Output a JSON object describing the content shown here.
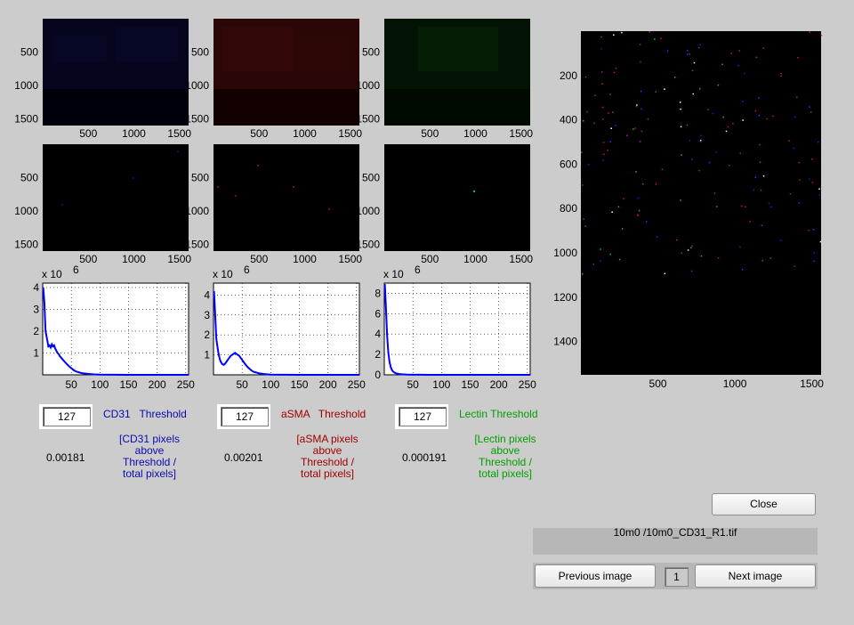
{
  "colors": {
    "cd31": "#0a0ab4",
    "asma": "#a00000",
    "lectin": "#00a000",
    "hist_line": "#0000ff"
  },
  "channels": [
    {
      "name": "CD31",
      "label": "CD31   Threshold",
      "threshold": "127",
      "ratio": "0.00181",
      "desc": [
        "[CD31 pixels",
        "above",
        "Threshold /",
        "total pixels]"
      ],
      "color_key": "cd31"
    },
    {
      "name": "aSMA",
      "label": "aSMA   Threshold",
      "threshold": "127",
      "ratio": "0.00201",
      "desc": [
        "[aSMA pixels",
        "above",
        "Threshold /",
        "total pixels]"
      ],
      "color_key": "asma"
    },
    {
      "name": "Lectin",
      "label": "Lectin Threshold",
      "threshold": "127",
      "ratio": "0.000191",
      "desc": [
        "[Lectin pixels",
        "above",
        "Threshold /",
        "total pixels]"
      ],
      "color_key": "lectin"
    }
  ],
  "image_axes": {
    "x_ticks": [
      "500",
      "1000",
      "1500"
    ],
    "y_ticks": [
      "500",
      "1000",
      "1500"
    ]
  },
  "composite_axes": {
    "x_ticks": [
      "500",
      "1000",
      "1500"
    ],
    "y_ticks": [
      "200",
      "400",
      "600",
      "800",
      "1000",
      "1200",
      "1400"
    ]
  },
  "chart_data": [
    {
      "type": "line",
      "name": "CD31 histogram",
      "exponent_label": "x 10",
      "exponent": "6",
      "x_ticks": [
        "50",
        "100",
        "150",
        "200",
        "250"
      ],
      "y_ticks": [
        "1",
        "2",
        "3",
        "4"
      ],
      "xlim": [
        0,
        255
      ],
      "ylim": [
        0,
        4.2
      ],
      "x": [
        1,
        3,
        5,
        8,
        10,
        12,
        14,
        16,
        18,
        20,
        22,
        24,
        26,
        28,
        30,
        35,
        40,
        45,
        50,
        55,
        60,
        65,
        70,
        80,
        90,
        100,
        120,
        150,
        200,
        255
      ],
      "y": [
        4.0,
        3.3,
        2.0,
        1.6,
        1.3,
        1.35,
        1.25,
        1.4,
        1.3,
        1.35,
        1.2,
        1.1,
        1.0,
        0.95,
        0.85,
        0.7,
        0.55,
        0.42,
        0.3,
        0.2,
        0.14,
        0.1,
        0.07,
        0.04,
        0.02,
        0.01,
        0.005,
        0.002,
        0.0,
        0.0
      ]
    },
    {
      "type": "line",
      "name": "aSMA histogram",
      "exponent_label": "x 10",
      "exponent": "6",
      "x_ticks": [
        "50",
        "100",
        "150",
        "200",
        "250"
      ],
      "y_ticks": [
        "1",
        "2",
        "3",
        "4"
      ],
      "xlim": [
        0,
        255
      ],
      "ylim": [
        0,
        4.6
      ],
      "x": [
        1,
        3,
        5,
        8,
        10,
        12,
        15,
        18,
        20,
        25,
        30,
        35,
        38,
        40,
        45,
        50,
        55,
        60,
        65,
        70,
        80,
        90,
        100,
        120,
        150,
        200,
        255
      ],
      "y": [
        4.2,
        3.0,
        1.8,
        1.2,
        0.9,
        0.7,
        0.55,
        0.5,
        0.55,
        0.75,
        0.95,
        1.05,
        1.1,
        1.05,
        0.95,
        0.75,
        0.55,
        0.38,
        0.25,
        0.15,
        0.07,
        0.03,
        0.015,
        0.005,
        0.002,
        0.0,
        0.0
      ]
    },
    {
      "type": "line",
      "name": "Lectin histogram",
      "exponent_label": "x 10",
      "exponent": "6",
      "x_ticks": [
        "50",
        "100",
        "150",
        "200",
        "250"
      ],
      "y_ticks": [
        "0",
        "2",
        "4",
        "6",
        "8"
      ],
      "xlim": [
        0,
        255
      ],
      "ylim": [
        0,
        9
      ],
      "x": [
        1,
        3,
        5,
        7,
        9,
        11,
        13,
        15,
        18,
        20,
        25,
        30,
        40,
        50,
        60,
        80,
        100,
        150,
        200,
        255
      ],
      "y": [
        8.9,
        6.5,
        3.8,
        2.2,
        1.3,
        0.8,
        0.5,
        0.35,
        0.22,
        0.16,
        0.09,
        0.05,
        0.02,
        0.01,
        0.005,
        0.002,
        0.0,
        0.0,
        0.0,
        0.0
      ]
    }
  ],
  "controls": {
    "close_label": "Close",
    "file_path": "10m0 /10m0_CD31_R1.tif",
    "prev_label": "Previous image",
    "next_label": "Next image",
    "page_number": "1"
  }
}
